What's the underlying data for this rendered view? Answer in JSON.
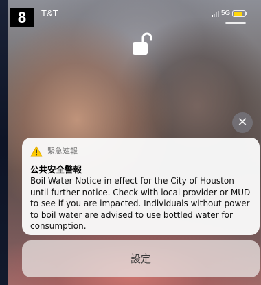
{
  "badge": "8",
  "status_bar": {
    "carrier": "T&T",
    "network": "5G",
    "battery_level": 0.8,
    "battery_color": "#ffd60a"
  },
  "lock_icon": "unlocked-padlock-icon",
  "dismiss_button": {
    "symbol": "✕"
  },
  "notification": {
    "app_name": "緊急速報",
    "title": "公共安全警報",
    "body": "Boil Water Notice in effect for the City of Houston until further notice. Check with local provider or MUD to see if you are impacted. Individuals without power to boil water are advised to use bottled water for consumption.",
    "icon": "warning-triangle-icon",
    "icon_color": "#ffcc00"
  },
  "settings_button": {
    "label": "設定"
  }
}
